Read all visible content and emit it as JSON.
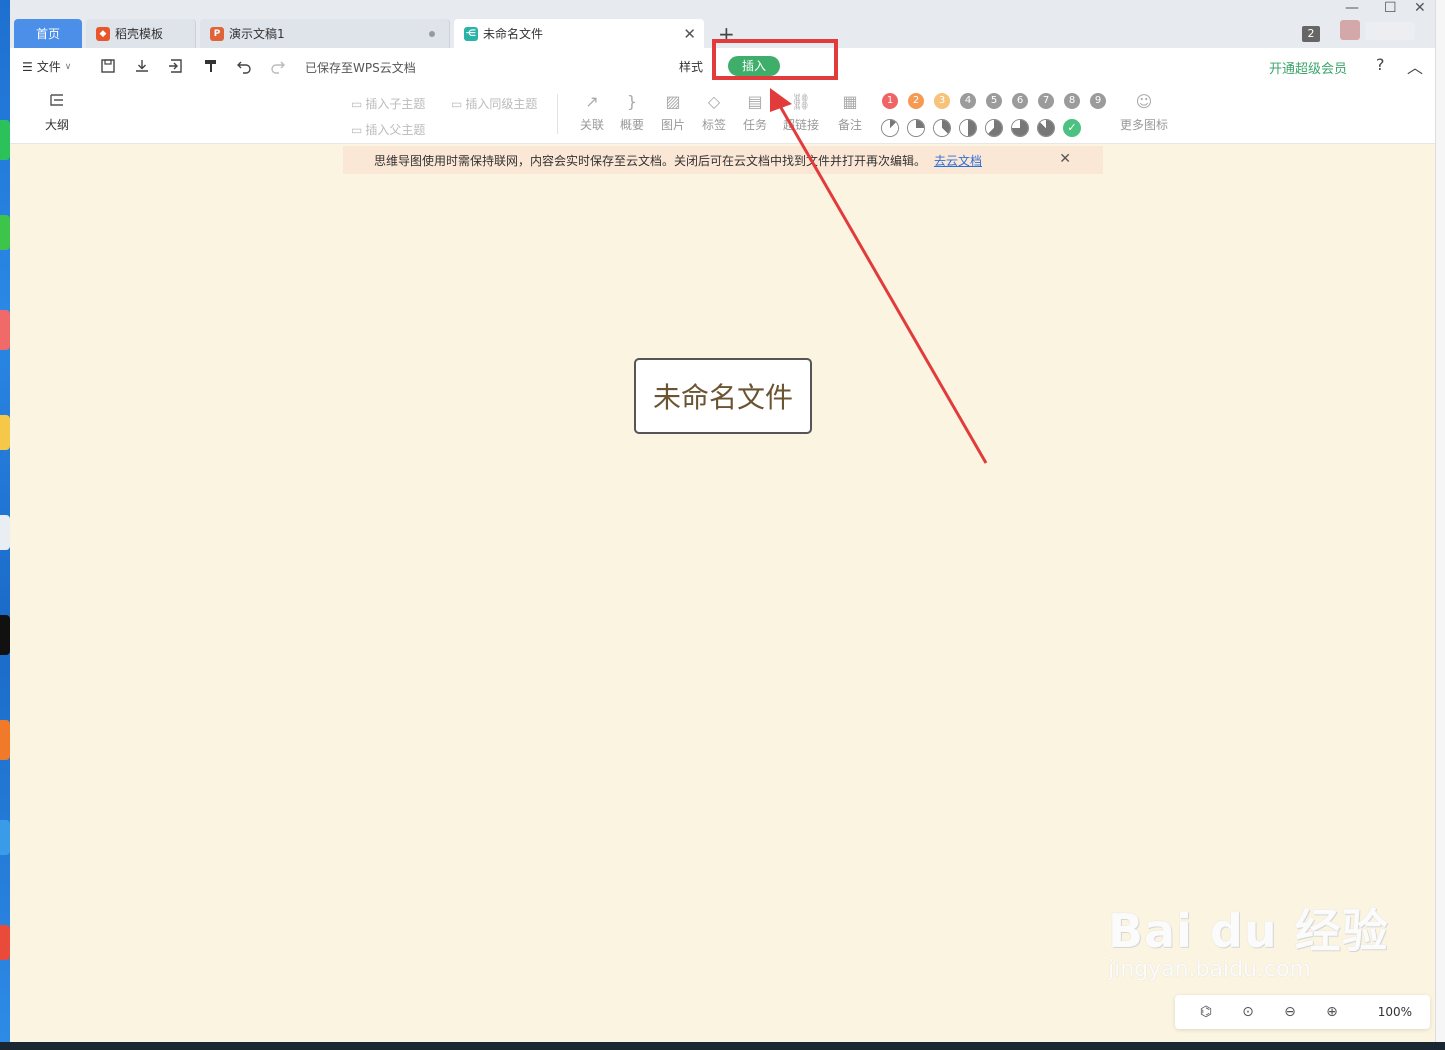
{
  "tabs": {
    "home": "首页",
    "template": "稻壳模板",
    "ppt": "演示文稿1",
    "active": "未命名文件",
    "new_tab_symbol": "+",
    "window_count": "2"
  },
  "menu": {
    "file": "文件",
    "saved_status": "已保存至WPS云文档",
    "style_tab": "样式",
    "insert_tab": "插入",
    "vip": "开通超级会员",
    "help": "?"
  },
  "ribbon": {
    "outline": "大纲",
    "insert_child": "插入子主题",
    "insert_sibling": "插入同级主题",
    "insert_parent": "插入父主题",
    "relate": "关联",
    "summary": "概要",
    "image": "图片",
    "tag": "标签",
    "task": "任务",
    "hyperlink": "超链接",
    "note": "备注",
    "more_icons": "更多图标",
    "priority": [
      "1",
      "2",
      "3",
      "4",
      "5",
      "6",
      "7",
      "8",
      "9"
    ],
    "priority_colors": [
      "#f06464",
      "#f59a52",
      "#f7c27a",
      "#9b9b9b",
      "#9b9b9b",
      "#9b9b9b",
      "#9b9b9b",
      "#9b9b9b",
      "#9b9b9b"
    ],
    "progress_levels": [
      0.125,
      0.25,
      0.375,
      0.5,
      0.625,
      0.75,
      0.875,
      1.0
    ]
  },
  "notice": {
    "text": "思维导图使用时需保持联网，内容会实时保存至云文档。关闭后可在云文档中找到文件并打开再次编辑。",
    "link": "去云文档"
  },
  "canvas": {
    "root_topic": "未命名文件"
  },
  "watermark": {
    "main": "Bai du 经验",
    "sub": "jingyan.baidu.com"
  },
  "zoom": {
    "value": "100%"
  },
  "colors": {
    "accent_green": "#3fae6b",
    "tab_blue": "#4b8fe8",
    "canvas_bg": "#fbf4e1",
    "annotation_red": "#e23b3b"
  }
}
